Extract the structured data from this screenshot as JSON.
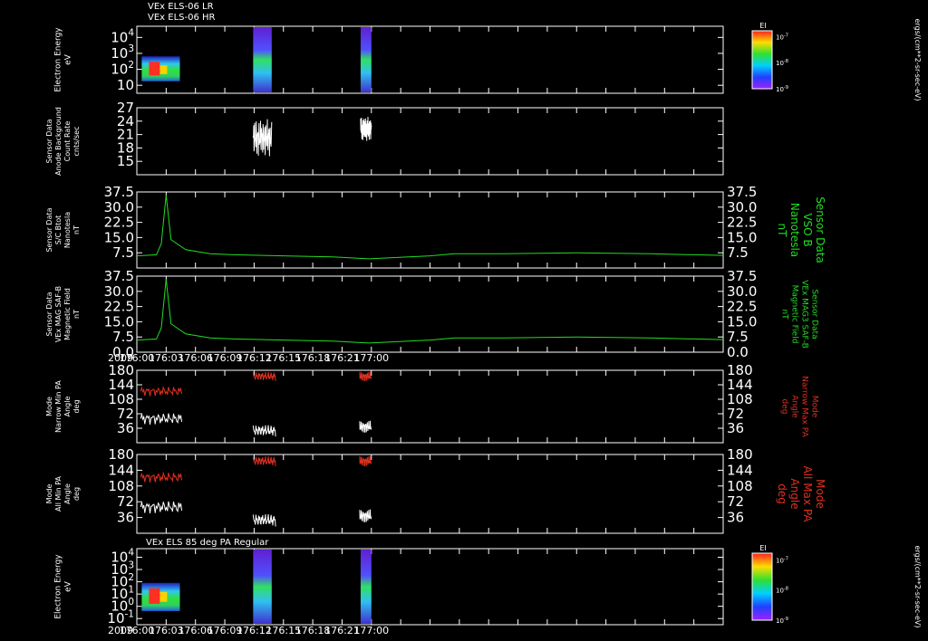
{
  "header": {
    "line1": "VEx ELS-06 LR",
    "line2": "VEx ELS-06 HR"
  },
  "colors": {
    "background": "#000000",
    "white": "#ffffff",
    "green": "#22dd22",
    "red": "#e03020"
  },
  "chart_data": [
    {
      "id": "p1",
      "type": "heatmap",
      "ylabel": [
        "Electron Energy",
        "eV"
      ],
      "yscale": "log",
      "yticks": [
        "10",
        "10^2",
        "10^3",
        "10^4"
      ],
      "xlim": [
        "176:00",
        "177:00"
      ],
      "data_blocks": [
        {
          "x": [
            "176:00.5",
            "176:04.4"
          ],
          "y": [
            5,
            200
          ]
        },
        {
          "x": [
            "176:11.9",
            "176:13.8"
          ],
          "y": [
            1,
            20000
          ]
        },
        {
          "x": [
            "176:22.9",
            "176:24.0"
          ],
          "y": [
            1,
            20000
          ]
        }
      ],
      "colorbar": {
        "label": "EI",
        "ticks": [
          "10^-7",
          "10^-8",
          "10^-9"
        ],
        "units": "ergs/(cm**2-sr-sec-eV)"
      }
    },
    {
      "id": "p2",
      "type": "line",
      "ylabel": [
        "Sensor Data",
        "Anode Background",
        "Count Rate",
        "cnts/sec"
      ],
      "ylim": [
        12,
        27
      ],
      "yticks": [
        "15",
        "18",
        "21",
        "24",
        "27"
      ],
      "series": [
        {
          "color": "white",
          "x": [
            "176:11.9",
            "176:13.8"
          ],
          "range": [
            16,
            24.5
          ]
        },
        {
          "color": "white",
          "x": [
            "176:22.9",
            "176:24.0"
          ],
          "range": [
            19.5,
            25
          ]
        }
      ]
    },
    {
      "id": "p3",
      "type": "line",
      "ylabel": [
        "Sensor Data",
        "S/C Btot",
        "Nanotesla",
        "nT"
      ],
      "ylabel_right": [
        "Sensor Data",
        "VSO B",
        "Nanotesla",
        "nT"
      ],
      "ylim": [
        0,
        37.5
      ],
      "yticks": [
        "7.5",
        "15.0",
        "22.5",
        "30.0",
        "37.5"
      ],
      "series": [
        {
          "color": "green",
          "x": [
            "176:00",
            "177:00"
          ],
          "points": [
            [
              0,
              6
            ],
            [
              0.8,
              6.5
            ],
            [
              1.0,
              12
            ],
            [
              1.2,
              36
            ],
            [
              1.4,
              14
            ],
            [
              2,
              9
            ],
            [
              3,
              7
            ],
            [
              4,
              6.5
            ],
            [
              6,
              6
            ],
            [
              8,
              5.5
            ],
            [
              9.5,
              4.5
            ],
            [
              12,
              6
            ],
            [
              13,
              7
            ],
            [
              15,
              7
            ],
            [
              18,
              7.5
            ],
            [
              21,
              7
            ],
            [
              24,
              6.2
            ]
          ]
        }
      ]
    },
    {
      "id": "p4",
      "type": "line",
      "ylabel": [
        "Sensor Data",
        "VEx MAG SAF-B",
        "Magnetic Field",
        "nT"
      ],
      "ylabel_right": [
        "Sensor Data",
        "VEx MAG3 SAF-B",
        "Magnetic Field",
        "nT"
      ],
      "ylim": [
        0,
        37.5
      ],
      "yticks": [
        "0.0",
        "7.5",
        "15.0",
        "22.5",
        "30.0",
        "37.5"
      ],
      "xticks": [
        "176:00",
        "176:03",
        "176:06",
        "176:09",
        "176:12",
        "176:15",
        "176:18",
        "176:21",
        "177:00"
      ],
      "year": "2009",
      "series": [
        {
          "color": "green",
          "x": [
            "176:00",
            "177:00"
          ],
          "points": [
            [
              0,
              6
            ],
            [
              0.8,
              6.5
            ],
            [
              1.0,
              12
            ],
            [
              1.2,
              36
            ],
            [
              1.4,
              14
            ],
            [
              2,
              9
            ],
            [
              3,
              7
            ],
            [
              4,
              6.5
            ],
            [
              6,
              6
            ],
            [
              8,
              5.5
            ],
            [
              9.5,
              4.5
            ],
            [
              12,
              6
            ],
            [
              13,
              7
            ],
            [
              15,
              7
            ],
            [
              18,
              7.5
            ],
            [
              21,
              7
            ],
            [
              24,
              6.2
            ]
          ]
        }
      ]
    },
    {
      "id": "p5",
      "type": "line",
      "ylabel": [
        "Mode",
        "Narrow Min PA",
        "Angle",
        "deg"
      ],
      "ylabel_right": [
        "Mode",
        "Narrow Max PA",
        "Angle",
        "deg"
      ],
      "ylim": [
        0,
        180
      ],
      "yticks": [
        "36",
        "72",
        "108",
        "144",
        "180"
      ],
      "series": [
        {
          "name": "Max PA",
          "color": "red"
        },
        {
          "name": "Min PA",
          "color": "white"
        }
      ]
    },
    {
      "id": "p6",
      "type": "line",
      "ylabel": [
        "Mode",
        "All Min PA",
        "Angle",
        "deg"
      ],
      "ylabel_right": [
        "Mode",
        "All Max PA",
        "Angle",
        "deg"
      ],
      "ylim": [
        0,
        180
      ],
      "yticks": [
        "36",
        "72",
        "108",
        "144",
        "180"
      ],
      "series": [
        {
          "name": "Max PA",
          "color": "red"
        },
        {
          "name": "Min PA",
          "color": "white"
        }
      ]
    },
    {
      "id": "p7",
      "type": "heatmap",
      "title": "VEx ELS 85 deg PA Regular",
      "ylabel": [
        "Electron Energy",
        "eV"
      ],
      "yscale": "log",
      "yticks": [
        "10^-1",
        "10^0",
        "10^1",
        "10^2",
        "10^3",
        "10^4"
      ],
      "xticks": [
        "176:00",
        "176:03",
        "176:06",
        "176:09",
        "176:12",
        "176:15",
        "176:18",
        "176:21",
        "177:00"
      ],
      "year": "2009",
      "colorbar": {
        "label": "EI",
        "ticks": [
          "10^-7",
          "10^-8",
          "10^-9"
        ],
        "units": "ergs/(cm**2-sr-sec-eV)"
      }
    }
  ]
}
